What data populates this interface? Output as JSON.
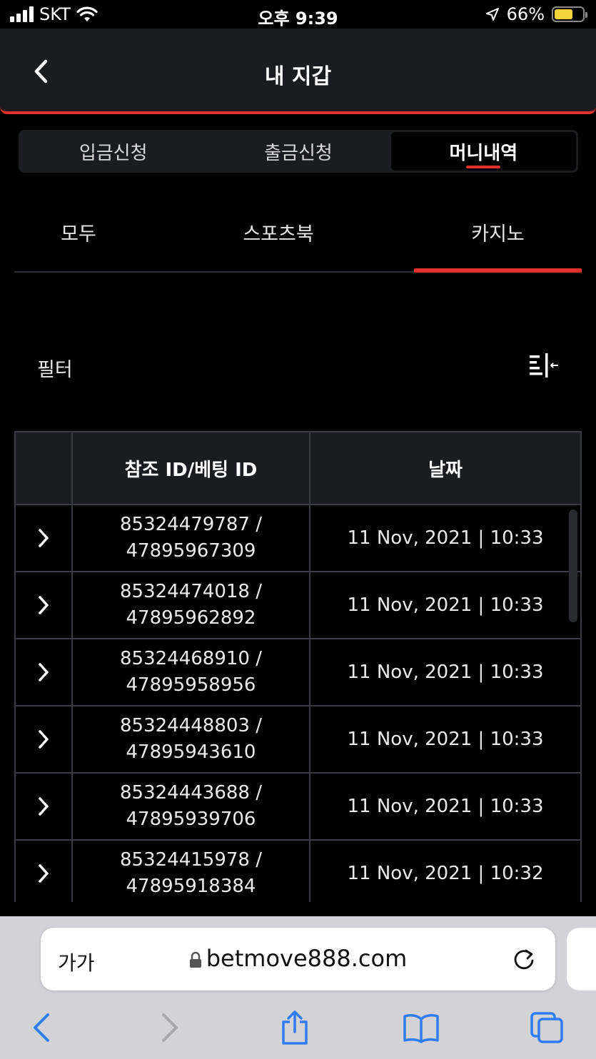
{
  "status_bar": {
    "carrier": "SKT",
    "time": "오후 9:39",
    "battery_percent": "66%",
    "battery_level": 0.66
  },
  "header": {
    "title": "내 지갑"
  },
  "segment_tabs": [
    {
      "label": "입금신청",
      "active": false
    },
    {
      "label": "출금신청",
      "active": false
    },
    {
      "label": "머니내역",
      "active": true
    }
  ],
  "sub_tabs": [
    {
      "label": "모두",
      "active": false
    },
    {
      "label": "스포츠북",
      "active": false
    },
    {
      "label": "카지노",
      "active": true
    }
  ],
  "filter": {
    "label": "필터"
  },
  "table": {
    "headers": [
      "",
      "참조 ID/베팅 ID",
      "날짜"
    ],
    "rows": [
      {
        "ref_id": "85324479787 /",
        "bet_id": "47895967309",
        "date": "11 Nov, 2021 | 10:33"
      },
      {
        "ref_id": "85324474018 /",
        "bet_id": "47895962892",
        "date": "11 Nov, 2021 | 10:33"
      },
      {
        "ref_id": "85324468910 /",
        "bet_id": "47895958956",
        "date": "11 Nov, 2021 | 10:33"
      },
      {
        "ref_id": "85324448803 /",
        "bet_id": "47895943610",
        "date": "11 Nov, 2021 | 10:33"
      },
      {
        "ref_id": "85324443688 /",
        "bet_id": "47895939706",
        "date": "11 Nov, 2021 | 10:33"
      },
      {
        "ref_id": "85324415978 /",
        "bet_id": "47895918384",
        "date": "11 Nov, 2021 | 10:32"
      }
    ]
  },
  "browser": {
    "text_size_label": "가가",
    "url": "betmove888.com"
  },
  "colors": {
    "accent": "#e0312b",
    "panel": "#1b1c20",
    "battery": "#f7d43a",
    "safari_blue": "#2f7cf6"
  }
}
